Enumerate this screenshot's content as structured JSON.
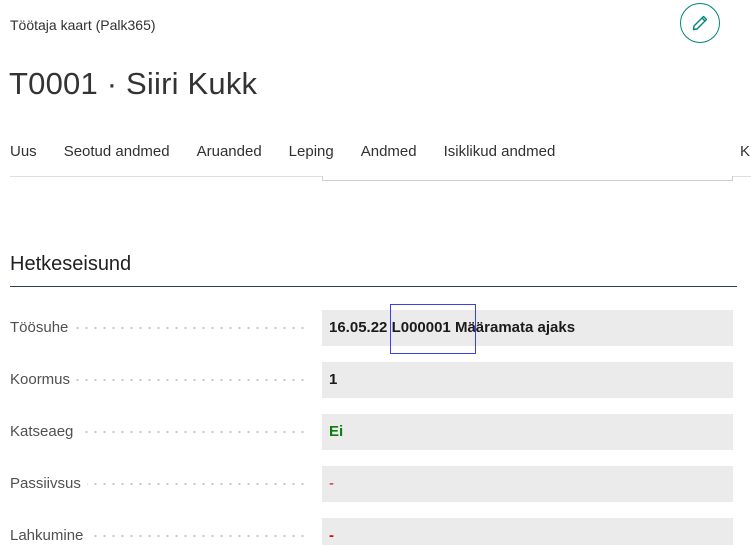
{
  "header": {
    "caption": "Töötaja kaart (Palk365)",
    "title": "T0001 · Siiri Kukk",
    "edit_icon": "pencil-icon"
  },
  "actions": [
    "Uus",
    "Seotud andmed",
    "Aruanded",
    "Leping",
    "Andmed",
    "Isiklikud andmed",
    "K"
  ],
  "section": {
    "title": "Hetkeseisund",
    "fields": [
      {
        "label": "Töösuhe",
        "value_date": "16.05.22",
        "value_code": "L000001",
        "value_text": "Määramata ajaks"
      },
      {
        "label": "Koormus",
        "value": "1"
      },
      {
        "label": "Katseaeg",
        "value": "Ei"
      },
      {
        "label": "Passiivsus",
        "value": "-"
      },
      {
        "label": "Lahkumine",
        "value": "-"
      }
    ]
  },
  "colors": {
    "accent": "#00857a",
    "green": "#107c10",
    "red": "#c50f1f",
    "focus": "#3a3ff0"
  }
}
